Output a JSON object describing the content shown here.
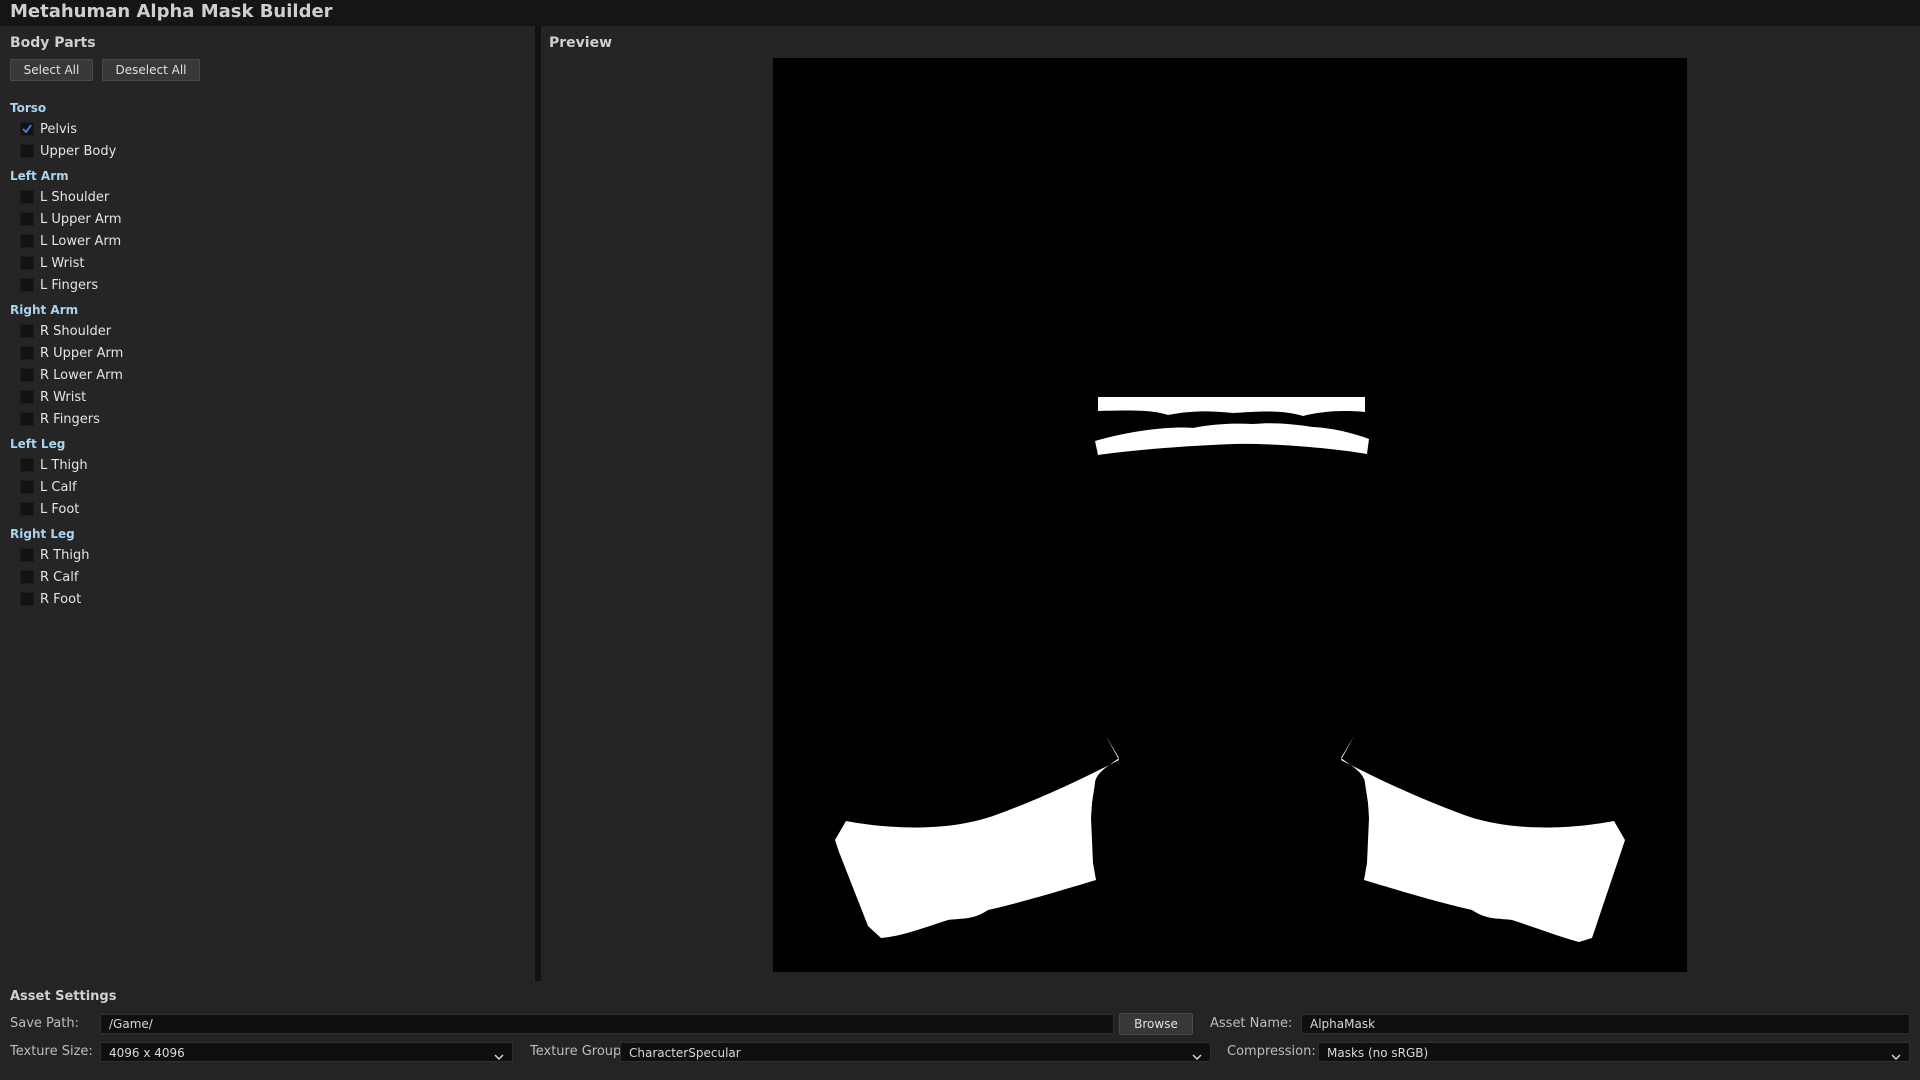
{
  "window": {
    "title": "Metahuman Alpha Mask Builder"
  },
  "body_parts": {
    "title": "Body Parts",
    "select_all_label": "Select All",
    "deselect_all_label": "Deselect All",
    "groups": [
      {
        "name": "Torso",
        "items": [
          {
            "label": "Pelvis",
            "checked": true
          },
          {
            "label": "Upper Body",
            "checked": false
          }
        ]
      },
      {
        "name": "Left Arm",
        "items": [
          {
            "label": "L Shoulder",
            "checked": false
          },
          {
            "label": "L Upper Arm",
            "checked": false
          },
          {
            "label": "L Lower Arm",
            "checked": false
          },
          {
            "label": "L Wrist",
            "checked": false
          },
          {
            "label": "L Fingers",
            "checked": false
          }
        ]
      },
      {
        "name": "Right Arm",
        "items": [
          {
            "label": "R Shoulder",
            "checked": false
          },
          {
            "label": "R Upper Arm",
            "checked": false
          },
          {
            "label": "R Lower Arm",
            "checked": false
          },
          {
            "label": "R Wrist",
            "checked": false
          },
          {
            "label": "R Fingers",
            "checked": false
          }
        ]
      },
      {
        "name": "Left Leg",
        "items": [
          {
            "label": "L Thigh",
            "checked": false
          },
          {
            "label": "L Calf",
            "checked": false
          },
          {
            "label": "L Foot",
            "checked": false
          }
        ]
      },
      {
        "name": "Right Leg",
        "items": [
          {
            "label": "R Thigh",
            "checked": false
          },
          {
            "label": "R Calf",
            "checked": false
          },
          {
            "label": "R Foot",
            "checked": false
          }
        ]
      }
    ]
  },
  "preview": {
    "title": "Preview"
  },
  "asset_settings": {
    "title": "Asset Settings",
    "save_path_label": "Save Path:",
    "save_path_value": "/Game/",
    "browse_label": "Browse",
    "asset_name_label": "Asset Name:",
    "asset_name_value": "AlphaMask",
    "texture_size_label": "Texture Size:",
    "texture_size_value": "4096 x 4096",
    "texture_group_label": "Texture Group:",
    "texture_group_value": "CharacterSpecular",
    "compression_label": "Compression:",
    "compression_value": "Masks (no sRGB)"
  },
  "colors": {
    "group_label": "#a8d4f0",
    "checkmark": "#3d8ee8",
    "mask_white": "#ffffff",
    "mask_background": "#000000"
  }
}
